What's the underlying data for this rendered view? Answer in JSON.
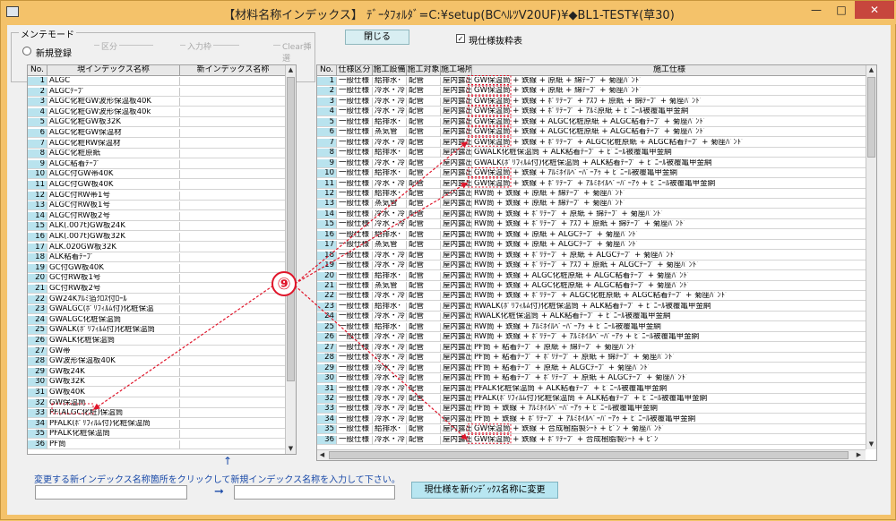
{
  "window": {
    "title": "【材料名称インデックス】 ﾃﾞｰﾀﾌｫﾙﾀﾞ=C:¥setup(BCﾍﾙﾂV20UF)¥◆BL1-TEST¥(草30)",
    "min_glyph": "—",
    "max_glyph": "□",
    "close_glyph": "✕"
  },
  "mode_group": {
    "legend": "メンテモード",
    "new_label": "新規登録",
    "kubun_label": "区分",
    "input_label": "入力枠",
    "clear_label": "Clear挿選"
  },
  "close_button": "閉じる",
  "current_checkbox": {
    "label": "現仕様抜粋表",
    "checked": true,
    "mark": "✓"
  },
  "left_table": {
    "headers": [
      "No.",
      "現インデックス名称",
      "新インデックス名称"
    ],
    "rows": [
      {
        "no": "1",
        "name": "ALGC"
      },
      {
        "no": "2",
        "name": "ALGCﾃｰﾌﾟ"
      },
      {
        "no": "3",
        "name": "ALGC化粧GW波形保温板40K"
      },
      {
        "no": "4",
        "name": "ALGC化粧GW波形保温板40k"
      },
      {
        "no": "5",
        "name": "ALGC化粧GW板32K"
      },
      {
        "no": "6",
        "name": "ALGC化粧GW保温材"
      },
      {
        "no": "7",
        "name": "ALGC化粧RW保温材"
      },
      {
        "no": "8",
        "name": "ALGC化粧原紙"
      },
      {
        "no": "9",
        "name": "ALGC粘着ﾃｰﾌﾟ"
      },
      {
        "no": "10",
        "name": "ALGC付GW帯40K"
      },
      {
        "no": "11",
        "name": "ALGC付GW板40K"
      },
      {
        "no": "12",
        "name": "ALGC付RW帯1号"
      },
      {
        "no": "13",
        "name": "ALGC付RW板1号"
      },
      {
        "no": "14",
        "name": "ALGC付RW板2号"
      },
      {
        "no": "15",
        "name": "ALK(.007t)GW板24K"
      },
      {
        "no": "16",
        "name": "ALK(.007t)GW板32K"
      },
      {
        "no": "17",
        "name": "ALK.020GW板32K"
      },
      {
        "no": "18",
        "name": "ALK粘着ﾃｰﾌﾟ"
      },
      {
        "no": "19",
        "name": "GC付GW板40K"
      },
      {
        "no": "20",
        "name": "GC付RW板1号"
      },
      {
        "no": "21",
        "name": "GC付RW板2号"
      },
      {
        "no": "22",
        "name": "GW24Kｱﾙﾐ箔ｸﾛｽ付ﾛｰﾙ"
      },
      {
        "no": "23",
        "name": "GWALGC(ﾎﾟﾘﾌｨﾙﾑ付)化粧保温"
      },
      {
        "no": "24",
        "name": "GWALGC化粧保温筒"
      },
      {
        "no": "25",
        "name": "GWALK(ﾎﾟﾘﾌｨﾙﾑ付)化粧保温筒"
      },
      {
        "no": "26",
        "name": "GWALK化粧保温筒"
      },
      {
        "no": "27",
        "name": "GW帯"
      },
      {
        "no": "28",
        "name": "GW波形保温板40K"
      },
      {
        "no": "29",
        "name": "GW板24K"
      },
      {
        "no": "30",
        "name": "GW板32K"
      },
      {
        "no": "31",
        "name": "GW板40K"
      },
      {
        "no": "32",
        "name": "GW保温筒"
      },
      {
        "no": "33",
        "name": "PF(ALGC化粧)保温筒"
      },
      {
        "no": "34",
        "name": "PFALK(ﾎﾟﾘﾌｨﾙﾑ付)化粧保温筒"
      },
      {
        "no": "35",
        "name": "PFALK化粧保温筒"
      },
      {
        "no": "36",
        "name": "PF筒"
      }
    ]
  },
  "right_table": {
    "headers": [
      "No.",
      "仕様区分",
      "施工設備",
      "施工対象",
      "施工場所",
      "施工仕様"
    ],
    "rows": [
      {
        "no": "1",
        "k": "一般仕様",
        "s": "給排水･",
        "t": "配管",
        "p": "屋内露出",
        "spec": "GW保温筒 + 鉄線 + 原紙 + 綿ﾃｰﾌﾟ + 菊座ﾊﾞﾝﾄﾞ"
      },
      {
        "no": "2",
        "k": "一般仕様",
        "s": "冷水・冷",
        "t": "配管",
        "p": "屋内露出",
        "spec": "GW保温筒 + 鉄線 + 原紙 + 綿ﾃｰﾌﾟ + 菊座ﾊﾞﾝﾄﾞ"
      },
      {
        "no": "3",
        "k": "一般仕様",
        "s": "冷水・冷",
        "t": "配管",
        "p": "屋内露出",
        "spec": "GW保温筒 + 鉄線 + ﾎﾟﾘﾃｰﾌﾟ + ｱｽﾌ + 原紙 + 綿ﾃｰﾌﾟ + 菊座ﾊﾞﾝﾄﾞ"
      },
      {
        "no": "4",
        "k": "一般仕様",
        "s": "冷水・冷",
        "t": "配管",
        "p": "屋内露出",
        "spec": "GW保温筒 + 鉄線 + ﾎﾟﾘﾃｰﾌﾟ + ｱﾙﾐ原紙 + ﾋﾞﾆｰﾙ被覆亀甲金網"
      },
      {
        "no": "5",
        "k": "一般仕様",
        "s": "給排水･",
        "t": "配管",
        "p": "屋内露出",
        "spec": "GW保温筒 + 鉄線 + ALGC化粧原紙 + ALGC粘着ﾃｰﾌﾟ + 菊座ﾊﾞﾝﾄﾞ"
      },
      {
        "no": "6",
        "k": "一般仕様",
        "s": "蒸気管",
        "t": "配管",
        "p": "屋内露出",
        "spec": "GW保温筒 + 鉄線 + ALGC化粧原紙 + ALGC粘着ﾃｰﾌﾟ + 菊座ﾊﾞﾝﾄﾞ"
      },
      {
        "no": "7",
        "k": "一般仕様",
        "s": "冷水・冷",
        "t": "配管",
        "p": "屋内露出",
        "spec": "GW保温筒 + 鉄線 + ﾎﾟﾘﾃｰﾌﾟ + ALGC化粧原紙 + ALGC粘着ﾃｰﾌﾟ + 菊座ﾊﾞﾝﾄﾞ"
      },
      {
        "no": "8",
        "k": "一般仕様",
        "s": "給排水･",
        "t": "配管",
        "p": "屋内露出",
        "spec": "GWALK化粧保温筒 + ALK粘着ﾃｰﾌﾟ + ﾋﾞﾆｰﾙ被覆亀甲金網"
      },
      {
        "no": "9",
        "k": "一般仕様",
        "s": "冷水・冷",
        "t": "配管",
        "p": "屋内露出",
        "spec": "GWALK(ﾎﾟﾘﾌｨﾙﾑ付)化粧保温筒 + ALK粘着ﾃｰﾌﾟ + ﾋﾞﾆｰﾙ被覆亀甲金網"
      },
      {
        "no": "10",
        "k": "一般仕様",
        "s": "給排水･",
        "t": "配管",
        "p": "屋内露出",
        "spec": "GW保温筒 + 鉄線 + ｱﾙﾐﾎｲﾙﾍﾟｰﾊﾟｰｱｩ + ﾋﾞﾆｰﾙ被覆亀甲金網"
      },
      {
        "no": "11",
        "k": "一般仕様",
        "s": "冷水・冷",
        "t": "配管",
        "p": "屋内露出",
        "spec": "GW保温筒 + 鉄線 + ﾎﾟﾘﾃｰﾌﾟ + ｱﾙﾐﾎｲﾙﾍﾟｰﾊﾟｰｱｩ + ﾋﾞﾆｰﾙ被覆亀甲金網"
      },
      {
        "no": "12",
        "k": "一般仕様",
        "s": "給排水･",
        "t": "配管",
        "p": "屋内露出",
        "spec": "RW筒 + 鉄線 + 原紙 + 綿ﾃｰﾌﾟ + 菊座ﾊﾞﾝﾄﾞ"
      },
      {
        "no": "13",
        "k": "一般仕様",
        "s": "蒸気管",
        "t": "配管",
        "p": "屋内露出",
        "spec": "RW筒 + 鉄線 + 原紙 + 綿ﾃｰﾌﾟ + 菊座ﾊﾞﾝﾄﾞ"
      },
      {
        "no": "14",
        "k": "一般仕様",
        "s": "冷水・冷",
        "t": "配管",
        "p": "屋内露出",
        "spec": "RW筒 + 鉄線 + ﾎﾟﾘﾃｰﾌﾟ + 原紙 + 綿ﾃｰﾌﾟ + 菊座ﾊﾞﾝﾄﾞ"
      },
      {
        "no": "15",
        "k": "一般仕様",
        "s": "冷水・冷",
        "t": "配管",
        "p": "屋内露出",
        "spec": "RW筒 + 鉄線 + ﾎﾟﾘﾃｰﾌﾟ + ｱｽﾌ + 原紙 + 綿ﾃｰﾌﾟ + 菊座ﾊﾞﾝﾄﾞ"
      },
      {
        "no": "16",
        "k": "一般仕様",
        "s": "給排水･",
        "t": "配管",
        "p": "屋内露出",
        "spec": "RW筒 + 鉄線 + 原紙 + ALGCﾃｰﾌﾟ + 菊座ﾊﾞﾝﾄﾞ"
      },
      {
        "no": "17",
        "k": "一般仕様",
        "s": "蒸気管",
        "t": "配管",
        "p": "屋内露出",
        "spec": "RW筒 + 鉄線 + 原紙 + ALGCﾃｰﾌﾟ + 菊座ﾊﾞﾝﾄﾞ"
      },
      {
        "no": "18",
        "k": "一般仕様",
        "s": "冷水・冷",
        "t": "配管",
        "p": "屋内露出",
        "spec": "RW筒 + 鉄線 + ﾎﾟﾘﾃｰﾌﾟ + 原紙 + ALGCﾃｰﾌﾟ + 菊座ﾊﾞﾝﾄﾞ"
      },
      {
        "no": "19",
        "k": "一般仕様",
        "s": "冷水・冷",
        "t": "配管",
        "p": "屋内露出",
        "spec": "RW筒 + 鉄線 + ﾎﾟﾘﾃｰﾌﾟ + ｱｽﾌ + 原紙 + ALGCﾃｰﾌﾟ + 菊座ﾊﾞﾝﾄﾞ"
      },
      {
        "no": "20",
        "k": "一般仕様",
        "s": "給排水･",
        "t": "配管",
        "p": "屋内露出",
        "spec": "RW筒 + 鉄線 + ALGC化粧原紙 + ALGC粘着ﾃｰﾌﾟ + 菊座ﾊﾞﾝﾄﾞ"
      },
      {
        "no": "21",
        "k": "一般仕様",
        "s": "蒸気管",
        "t": "配管",
        "p": "屋内露出",
        "spec": "RW筒 + 鉄線 + ALGC化粧原紙 + ALGC粘着ﾃｰﾌﾟ + 菊座ﾊﾞﾝﾄﾞ"
      },
      {
        "no": "22",
        "k": "一般仕様",
        "s": "冷水・冷",
        "t": "配管",
        "p": "屋内露出",
        "spec": "RW筒 + 鉄線 + ﾎﾟﾘﾃｰﾌﾟ + ALGC化粧原紙 + ALGC粘着ﾃｰﾌﾟ + 菊座ﾊﾞﾝﾄﾞ"
      },
      {
        "no": "23",
        "k": "一般仕様",
        "s": "給排水･",
        "t": "配管",
        "p": "屋内露出",
        "spec": "RWALK(ﾎﾟﾘﾌｨﾙﾑ付)化粧保温筒 + ALK粘着ﾃｰﾌﾟ + ﾋﾞﾆｰﾙ被覆亀甲金網"
      },
      {
        "no": "24",
        "k": "一般仕様",
        "s": "冷水・冷",
        "t": "配管",
        "p": "屋内露出",
        "spec": "RWALK化粧保温筒 + ALK粘着ﾃｰﾌﾟ + ﾋﾞﾆｰﾙ被覆亀甲金網"
      },
      {
        "no": "25",
        "k": "一般仕様",
        "s": "給排水･",
        "t": "配管",
        "p": "屋内露出",
        "spec": "RW筒 + 鉄線 + ｱﾙﾐﾎｲﾙﾍﾟｰﾊﾟｰｱｩ + ﾋﾞﾆｰﾙ被覆亀甲金網"
      },
      {
        "no": "26",
        "k": "一般仕様",
        "s": "冷水・冷",
        "t": "配管",
        "p": "屋内露出",
        "spec": "RW筒 + 鉄線 + ﾎﾟﾘﾃｰﾌﾟ + ｱﾙﾐﾎｲﾙﾍﾟｰﾊﾟｰｱｩ + ﾋﾞﾆｰﾙ被覆亀甲金網"
      },
      {
        "no": "27",
        "k": "一般仕様",
        "s": "冷水・冷",
        "t": "配管",
        "p": "屋内露出",
        "spec": "PF筒 + 粘着ﾃｰﾌﾟ + 原紙 + 綿ﾃｰﾌﾟ + 菊座ﾊﾞﾝﾄﾞ"
      },
      {
        "no": "28",
        "k": "一般仕様",
        "s": "冷水・冷",
        "t": "配管",
        "p": "屋内露出",
        "spec": "PF筒 + 粘着ﾃｰﾌﾟ + ﾎﾟﾘﾃｰﾌﾟ + 原紙 + 綿ﾃｰﾌﾟ + 菊座ﾊﾞﾝﾄﾞ"
      },
      {
        "no": "29",
        "k": "一般仕様",
        "s": "冷水・冷",
        "t": "配管",
        "p": "屋内露出",
        "spec": "PF筒 + 粘着ﾃｰﾌﾟ + 原紙 + ALGCﾃｰﾌﾟ + 菊座ﾊﾞﾝﾄﾞ"
      },
      {
        "no": "30",
        "k": "一般仕様",
        "s": "冷水・冷",
        "t": "配管",
        "p": "屋内露出",
        "spec": "PF筒 + 粘着ﾃｰﾌﾟ + ﾎﾟﾘﾃｰﾌﾟ + 原紙 + ALGCﾃｰﾌﾟ + 菊座ﾊﾞﾝﾄﾞ"
      },
      {
        "no": "31",
        "k": "一般仕様",
        "s": "冷水・冷",
        "t": "配管",
        "p": "屋内露出",
        "spec": "PFALK化粧保温筒 + ALK粘着ﾃｰﾌﾟ + ﾋﾞﾆｰﾙ被覆亀甲金網"
      },
      {
        "no": "32",
        "k": "一般仕様",
        "s": "冷水・冷",
        "t": "配管",
        "p": "屋内露出",
        "spec": "PFALK(ﾎﾟﾘﾌｨﾙﾑ付)化粧保温筒 + ALK粘着ﾃｰﾌﾟ + ﾋﾞﾆｰﾙ被覆亀甲金網"
      },
      {
        "no": "33",
        "k": "一般仕様",
        "s": "冷水・冷",
        "t": "配管",
        "p": "屋内露出",
        "spec": "PF筒 + 鉄線 + ｱﾙﾐﾎｲﾙﾍﾟｰﾊﾟｰｱｩ + ﾋﾞﾆｰﾙ被覆亀甲金網"
      },
      {
        "no": "34",
        "k": "一般仕様",
        "s": "冷水・冷",
        "t": "配管",
        "p": "屋内露出",
        "spec": "PF筒 + 鉄線 + ﾎﾟﾘﾃｰﾌﾟ + ｱﾙﾐﾎｲﾙﾍﾟｰﾊﾟｰｱｩ + ﾋﾞﾆｰﾙ被覆亀甲金網"
      },
      {
        "no": "35",
        "k": "一般仕様",
        "s": "給排水･",
        "t": "配管",
        "p": "屋内露出",
        "spec": "GW保温筒 + 鉄線 + 合成樹脂製ｼｰﾄ + ﾋﾟﾝ + 菊座ﾊﾞﾝﾄﾞ"
      },
      {
        "no": "36",
        "k": "一般仕様",
        "s": "冷水・冷",
        "t": "配管",
        "p": "屋内露出",
        "spec": "GW保温筒 + 鉄線 + ﾎﾟﾘﾃｰﾌﾟ + 合成樹脂製ｼｰﾄ + ﾋﾟﾝ"
      }
    ]
  },
  "instruction": "変更する新インデックス名称箇所をクリックして新規インデックス名称を入力して下さい。",
  "up_arrow": "↑",
  "right_arrow": "➞",
  "change_button": "現仕様を新ｲﾝﾃﾞｯｸｽ名称に変更",
  "scroll": {
    "up": "▲",
    "down": "▼",
    "left": "◀",
    "right": "▶"
  },
  "annotation": {
    "label": "⑨",
    "color": "#e0162b"
  },
  "colors": {
    "title_bar": "#f4c26a",
    "row_number": "#b9e3ee",
    "button": "#b8e6f1"
  }
}
